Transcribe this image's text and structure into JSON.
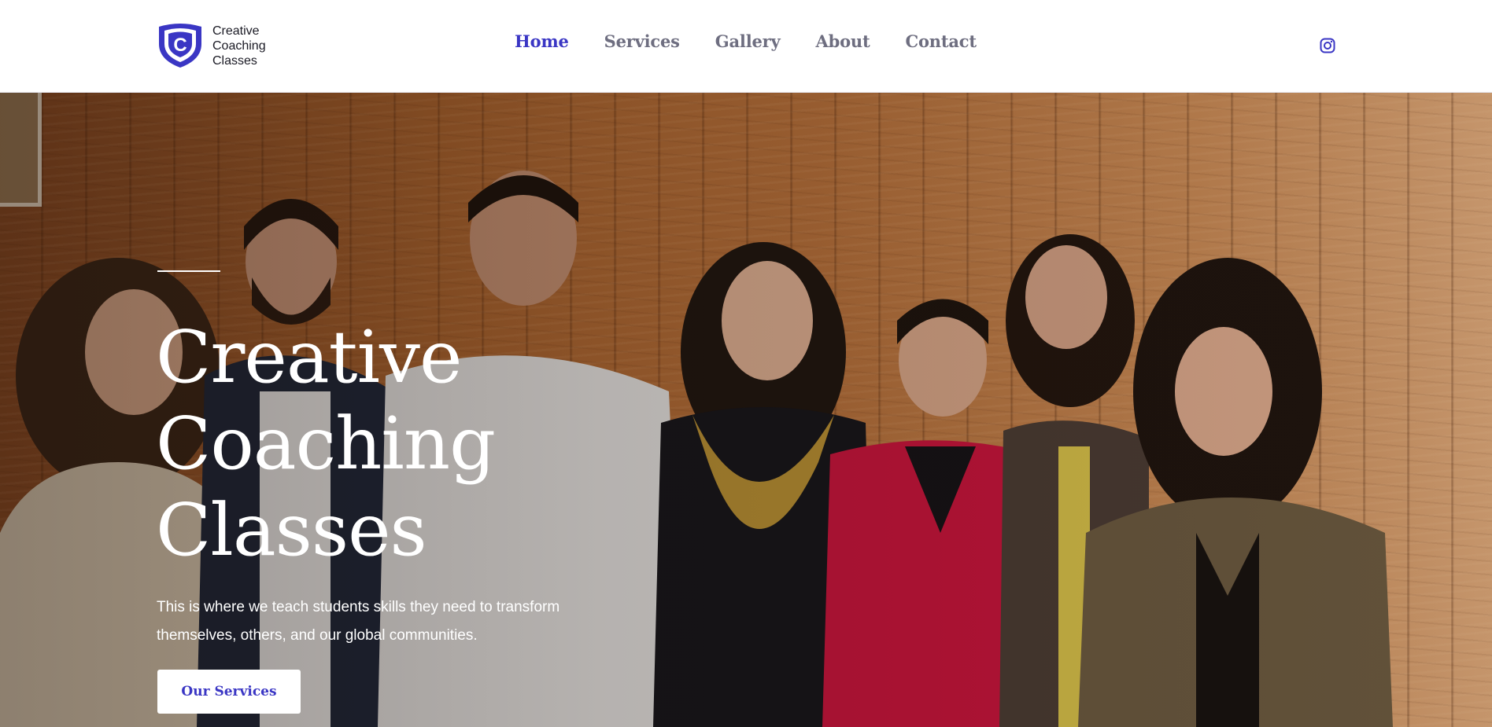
{
  "brand": {
    "name_line1": "Creative",
    "name_line2": "Coaching",
    "name_line3": "Classes",
    "logo_letter": "C",
    "accent_color": "#3a36c4"
  },
  "nav": {
    "items": [
      {
        "label": "Home",
        "active": true
      },
      {
        "label": "Services",
        "active": false
      },
      {
        "label": "Gallery",
        "active": false
      },
      {
        "label": "About",
        "active": false
      },
      {
        "label": "Contact",
        "active": false
      }
    ],
    "social_icon": "instagram-icon"
  },
  "hero": {
    "title_line1": "Creative",
    "title_line2": "Coaching",
    "title_line3": "Classes",
    "description": "This is where we teach students skills they need to transform themselves, others, and our global communities.",
    "button_label": "Our Services",
    "background_image": "group photo of seven teachers in front of a wooden wall"
  }
}
